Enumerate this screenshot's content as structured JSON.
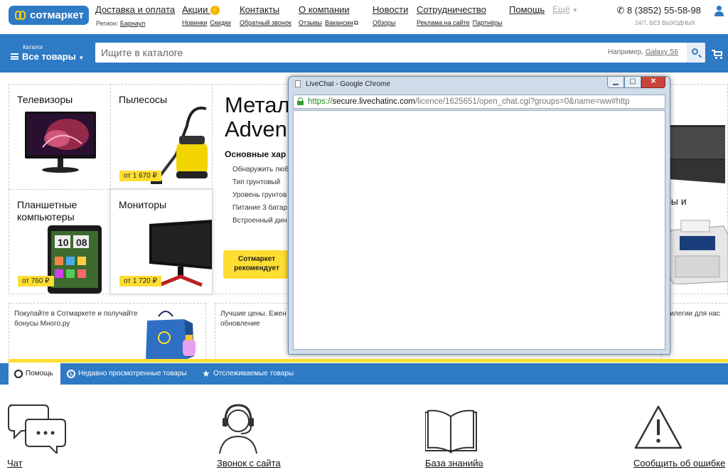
{
  "header": {
    "logo_text": "сотмаркет",
    "region_label": "Регион:",
    "region_value": "Барнаул",
    "nav": [
      {
        "label": "Доставка и оплата",
        "subs": []
      },
      {
        "label": "Акции",
        "subs": [
          "Новинки",
          "Скидки"
        ]
      },
      {
        "label": "Контакты",
        "subs": [
          "Обратный звонок"
        ]
      },
      {
        "label": "О компании",
        "subs": [
          "Отзывы",
          "Вакансии"
        ]
      },
      {
        "label": "Новости",
        "subs": [
          "Обзоры"
        ]
      },
      {
        "label": "Сотрудничество",
        "subs": [
          "Реклама на сайте",
          "Партнёры"
        ]
      },
      {
        "label": "Помощь",
        "subs": []
      }
    ],
    "more_label": "Ещё",
    "phone": "8 (3852) 55-58-98",
    "phone_sub": "24/7, БЕЗ ВЫХОДНЫХ"
  },
  "search": {
    "catalog_small": "Каталог",
    "catalog_label": "Все товары",
    "placeholder": "Ищите в каталоге",
    "example_prefix": "Например,",
    "example_value": "Galaxy S6"
  },
  "categories": [
    {
      "title": "Телевизоры",
      "price": ""
    },
    {
      "title": "Пылесосы",
      "price": "от 1 670 ₽"
    },
    {
      "title": "Планшетные компьютеры",
      "price": "от 760 ₽"
    },
    {
      "title": "Мониторы",
      "price": "от 1 720 ₽"
    }
  ],
  "promo": {
    "title_line1": "Метал",
    "title_line2": "Adven",
    "subtitle": "Основные хар",
    "features": [
      "Обнаружить люб",
      "Тип грунтовый",
      "Уровень грунтов",
      "Питание 3 батар",
      "Встроенный дин"
    ],
    "button_line1": "Сотмаркет",
    "button_line2": "рекомендует"
  },
  "right_partial_title": "ры и",
  "banners": [
    {
      "text_line1": "Покупайте в Сотмаркете и получайте",
      "text_line2": "бонусы Много.ру"
    },
    {
      "text_line1": "Лучшие цены. Ежен",
      "text_line2": "обновление"
    },
    {
      "text_line1": "вилегии для нас",
      "text_line2": ""
    }
  ],
  "tabs": [
    {
      "label": "Помощь"
    },
    {
      "label": "Недавно просмотренные товары"
    },
    {
      "label": "Отслеживаемые товары"
    }
  ],
  "help_items": [
    {
      "label": "Чат"
    },
    {
      "label": "Звонок с сайта"
    },
    {
      "label": "База знаний"
    },
    {
      "label": "Сообщить об ошибке"
    }
  ],
  "popup": {
    "title": "LiveChat - Google Chrome",
    "url_scheme": "https://",
    "url_host": "secure.livechatinc.com",
    "url_path": "/licence/1625651/open_chat.cgi?groups=0&name=ww#http"
  },
  "colors": {
    "brand_blue": "#2e7ac4",
    "accent_yellow": "#ffde33",
    "url_green": "#1e8a1e"
  }
}
